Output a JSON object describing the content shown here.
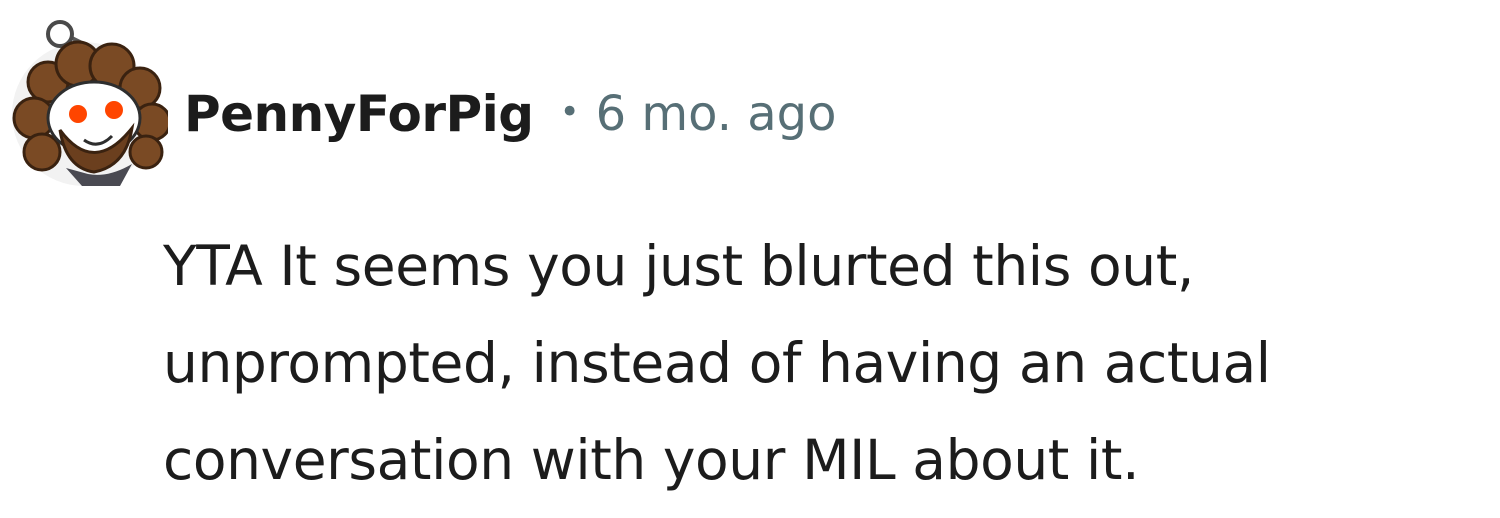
{
  "comment": {
    "author": "PennyForPig",
    "separator": "•",
    "timestamp": "6 mo. ago",
    "avatar_icon": "snoo-avatar-icon",
    "body_lines": [
      "YTA It seems you just blurted this out,",
      "unprompted, instead of having an actual",
      "conversation with your MIL about it."
    ]
  },
  "colors": {
    "author": "#1c1c1c",
    "meta": "#576f76",
    "body": "#1c1c1c",
    "background": "#ffffff"
  }
}
